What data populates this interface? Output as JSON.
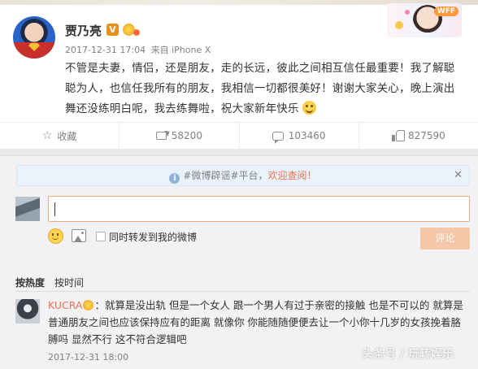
{
  "post": {
    "author_name": "贾乃亮",
    "verified_badge": "V",
    "timestamp": "2017-12-31 17:04",
    "via_label": "来自 iPhone X",
    "text": "不管是夫妻，情侣，还是朋友，走的长远，彼此之间相互信任最重要！我了解聪聪为人，也信任我所有的朋友，我相信一切都很美好！谢谢大家关心，晚上演出舞还没练明白呢，我去练舞啦，祝大家新年快乐",
    "text_emoji": "smile-emoji",
    "banner_tag": "WFF"
  },
  "actions": [
    {
      "label": "收藏",
      "icon": "star-icon"
    },
    {
      "label": "58200",
      "icon": "forward-icon"
    },
    {
      "label": "103460",
      "icon": "comment-icon"
    },
    {
      "label": "827590",
      "icon": "like-icon"
    }
  ],
  "notice": {
    "info_glyph": "i",
    "lead": "#微博辟谣#平台，",
    "link": "欢迎查阅！",
    "close": "✕"
  },
  "composer": {
    "repost_checkbox_label": "同时转发到我的微博",
    "submit_label": "评论"
  },
  "sort": {
    "active": "按热度",
    "inactive": "按时间"
  },
  "comments": [
    {
      "user": "KUCRA",
      "text": "：就算是没出轨 但是一个女人 跟一个男人有过于亲密的接触 也是不可以的 就算是普通朋友之间也应该保持应有的距离 就像你 你能随随便便去让一个小你十几岁的女孩挽着胳膊吗 显然不行 这不符合逻辑吧",
      "time": "2017-12-31 18:00"
    }
  ],
  "watermark": "头条号 / 玩转娱乐",
  "colors": {
    "accent": "#eb7350",
    "verified": "#ea9018",
    "submit_disabled": "#f5c6a7",
    "notice_bg": "#eaf2fb",
    "panel_bg": "#f2f2f5"
  }
}
